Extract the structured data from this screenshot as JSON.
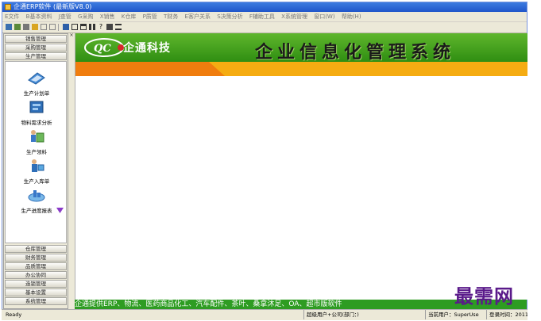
{
  "window": {
    "title": "企通ERP软件 (最新版V8.0)"
  },
  "menu": [
    "E文件",
    "B基本资料",
    "J查管",
    "G采购",
    "X销售",
    "K仓库",
    "P质管",
    "T财务",
    "E客户关系",
    "S决策分析",
    "F辅助工具",
    "X系统管理",
    "窗口(W)",
    "帮助(H)"
  ],
  "sidebar": {
    "top_groups": [
      "销售管理",
      "采购管理",
      "生产管理"
    ],
    "items": [
      {
        "label": "生产计划单",
        "icon": "production-plan-icon"
      },
      {
        "label": "物料需求分析",
        "icon": "material-analysis-icon"
      },
      {
        "label": "生产领料",
        "icon": "material-requisition-icon"
      },
      {
        "label": "生产入库单",
        "icon": "production-inbound-icon"
      },
      {
        "label": "生产进度报表",
        "icon": "progress-report-icon"
      }
    ],
    "bottom_groups": [
      "仓库管理",
      "财务管理",
      "品质管理",
      "办公协同",
      "连锁管理",
      "基本设置",
      "系统管理"
    ]
  },
  "banner": {
    "company": "企通科技",
    "system_title": "企业信息化管理系统"
  },
  "ticker": "企通提供ERP、物流、医药商品化工、汽车配件、茶叶、桑拿沐足、OA、超市版软件",
  "status": {
    "ready": "Ready",
    "user_company": "超级用户+公司(部门：)",
    "current_user": "当前用户：SuperUser",
    "login_time": "登录时间：2011-"
  },
  "watermark": "最需网",
  "colors": {
    "banner_green": "#3a9c1a",
    "orange": "#f5ac12",
    "ticker_green": "#2e9c22",
    "titlebar_blue": "#2a62d4"
  }
}
